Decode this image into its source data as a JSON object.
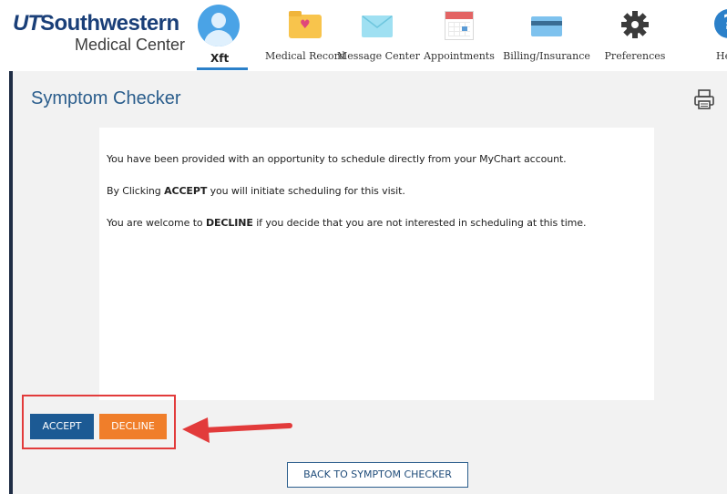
{
  "header": {
    "logo": {
      "line1_ut": "UT",
      "line1_rest": "Southwestern",
      "line2": "Medical Center"
    },
    "user": {
      "name": "Xft"
    },
    "nav": [
      {
        "label": "Medical Record",
        "icon": "medical-record-folder-icon"
      },
      {
        "label": "Message Center",
        "icon": "envelope-icon"
      },
      {
        "label": "Appointments",
        "icon": "calendar-icon"
      },
      {
        "label": "Billing/Insurance",
        "icon": "credit-card-icon"
      },
      {
        "label": "Preferences",
        "icon": "gear-icon"
      },
      {
        "label": "Help",
        "icon": "help-icon"
      }
    ]
  },
  "page": {
    "title": "Symptom Checker",
    "print_icon": "printer-icon"
  },
  "message": {
    "line1": "You have been provided with an opportunity to schedule directly from your MyChart account.",
    "line2_pre": "By Clicking ",
    "line2_bold": "ACCEPT",
    "line2_post": " you will initiate scheduling for this visit.",
    "line3_pre": "You are welcome to ",
    "line3_bold": "DECLINE",
    "line3_post": " if you decide that you are not interested in scheduling at this time."
  },
  "actions": {
    "accept": "ACCEPT",
    "decline": "DECLINE",
    "back": "BACK TO SYMPTOM CHECKER"
  },
  "colors": {
    "brand_blue": "#1a3f78",
    "accept_bg": "#1c5a94",
    "decline_bg": "#f07e2a",
    "highlight": "#e23b3b",
    "title": "#2a5d8c"
  }
}
